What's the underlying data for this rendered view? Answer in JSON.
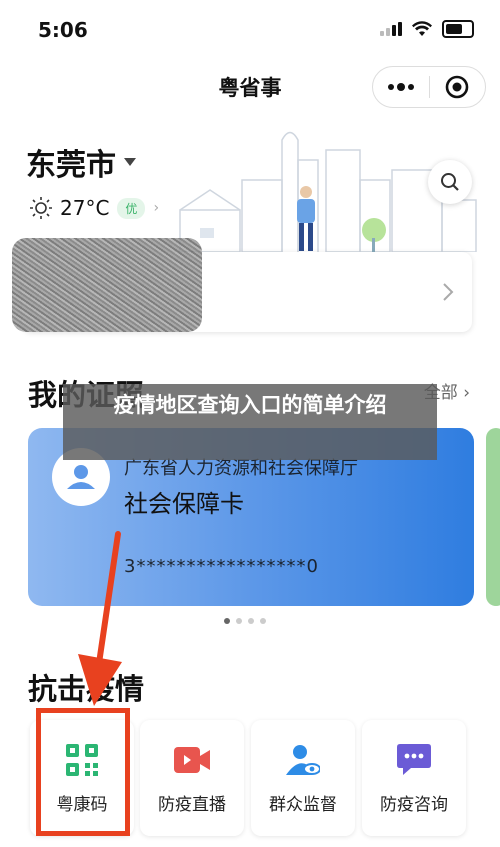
{
  "status_bar": {
    "time": "5:06"
  },
  "nav": {
    "title": "粤省事",
    "more_icon": "more-dots-icon",
    "close_icon": "target-circle-icon"
  },
  "location": {
    "city": "东莞市",
    "temperature": "27°C",
    "air_quality": "优"
  },
  "documents": {
    "title": "我的证照",
    "all_label": "全部",
    "card": {
      "issuer": "广东省人力资源和社会保障厅",
      "name": "社会保障卡",
      "number": "3*****************0"
    }
  },
  "banner": {
    "text": "疫情地区查询入口的简单介绍"
  },
  "epidemic": {
    "title": "抗击疫情",
    "services": [
      {
        "label": "粤康码",
        "icon": "qr-code-icon",
        "color": "#2bb673"
      },
      {
        "label": "防疫直播",
        "icon": "video-camera-icon",
        "color": "#e8554e"
      },
      {
        "label": "群众监督",
        "icon": "person-eye-icon",
        "color": "#2e8ce6"
      },
      {
        "label": "防疫咨询",
        "icon": "chat-bubble-icon",
        "color": "#6b5bd6"
      }
    ]
  },
  "colors": {
    "highlight_box": "#e8411f",
    "card_gradient_end": "#2f7de0"
  }
}
